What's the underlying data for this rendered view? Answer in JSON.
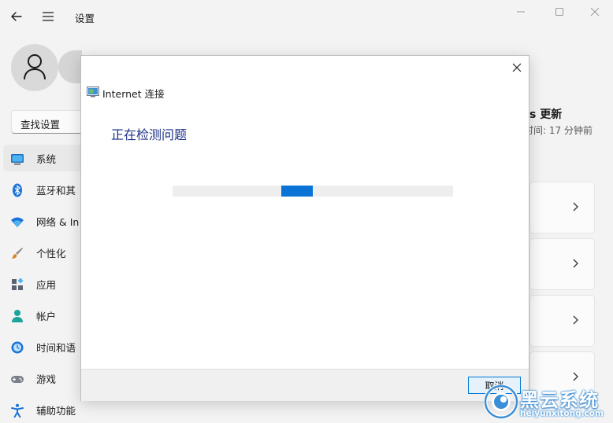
{
  "app": {
    "title": "设置"
  },
  "search": {
    "placeholder": "查找设置"
  },
  "nav": {
    "items": [
      {
        "label": "系统",
        "icon": "display-icon"
      },
      {
        "label": "蓝牙和其",
        "icon": "bluetooth-icon"
      },
      {
        "label": "网络 & In",
        "icon": "wifi-icon"
      },
      {
        "label": "个性化",
        "icon": "paintbrush-icon"
      },
      {
        "label": "应用",
        "icon": "apps-icon"
      },
      {
        "label": "帐户",
        "icon": "person-icon"
      },
      {
        "label": "时间和语",
        "icon": "globe-clock-icon"
      },
      {
        "label": "游戏",
        "icon": "gamepad-icon"
      },
      {
        "label": "辅助功能",
        "icon": "accessibility-icon"
      }
    ],
    "active_index": 0
  },
  "windows_update": {
    "title": "s 更新",
    "subtitle": "时间: 17 分钟前"
  },
  "dialog": {
    "app_name": "Internet 连接",
    "heading": "正在检测问题",
    "progress_state": "indeterminate",
    "cancel_label": "取消"
  },
  "watermark": {
    "name": "黑云系统",
    "url": "heiyunxitong.com"
  },
  "colors": {
    "accent": "#0067c0",
    "progress": "#0a74d6",
    "heading": "#1e3287",
    "background": "#f3f3f3"
  }
}
